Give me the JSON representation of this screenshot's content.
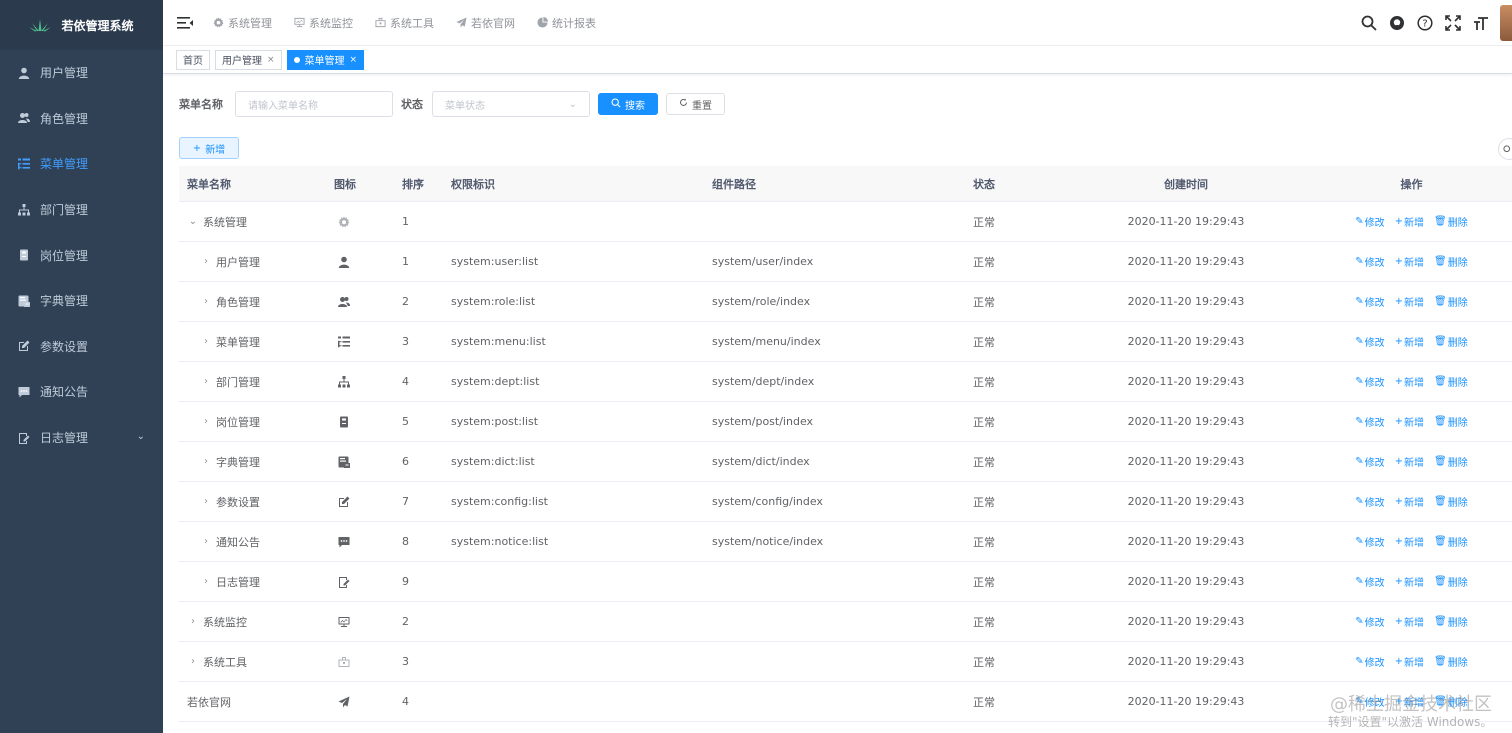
{
  "app": {
    "title": "若依管理系统"
  },
  "sidebar": {
    "items": [
      {
        "label": "用户管理",
        "icon": "user-icon"
      },
      {
        "label": "角色管理",
        "icon": "peoples-icon"
      },
      {
        "label": "菜单管理",
        "icon": "tree-table-icon",
        "active": true
      },
      {
        "label": "部门管理",
        "icon": "tree-icon"
      },
      {
        "label": "岗位管理",
        "icon": "post-icon"
      },
      {
        "label": "字典管理",
        "icon": "dict-icon"
      },
      {
        "label": "参数设置",
        "icon": "edit-icon"
      },
      {
        "label": "通知公告",
        "icon": "message-icon"
      },
      {
        "label": "日志管理",
        "icon": "log-icon",
        "has_children": true
      }
    ]
  },
  "navbar": {
    "menus": [
      {
        "label": "系统管理",
        "icon": "gear-icon"
      },
      {
        "label": "系统监控",
        "icon": "monitor-icon"
      },
      {
        "label": "系统工具",
        "icon": "tool-icon"
      },
      {
        "label": "若依官网",
        "icon": "send-icon"
      },
      {
        "label": "统计报表",
        "icon": "chart-icon"
      }
    ]
  },
  "tags": [
    {
      "label": "首页"
    },
    {
      "label": "用户管理",
      "closable": true
    },
    {
      "label": "菜单管理",
      "closable": true,
      "active": true
    }
  ],
  "search": {
    "menu_name_label": "菜单名称",
    "menu_name_placeholder": "请输入菜单名称",
    "status_label": "状态",
    "status_placeholder": "菜单状态",
    "search_button": "搜索",
    "reset_button": "重置"
  },
  "toolbar": {
    "add_button": "新增"
  },
  "table": {
    "headers": {
      "name": "菜单名称",
      "icon": "图标",
      "sort": "排序",
      "perms": "权限标识",
      "component": "组件路径",
      "status": "状态",
      "created": "创建时间",
      "ops": "操作"
    },
    "ops": {
      "edit": "修改",
      "add": "新增",
      "delete": "删除"
    },
    "rows": [
      {
        "name": "系统管理",
        "level": 0,
        "expander": "⌄",
        "icon": "gear-icon",
        "sort": "1",
        "perms": "",
        "component": "",
        "status": "正常",
        "created": "2020-11-20 19:29:43"
      },
      {
        "name": "用户管理",
        "level": 1,
        "expander": "›",
        "icon": "user-icon",
        "sort": "1",
        "perms": "system:user:list",
        "component": "system/user/index",
        "status": "正常",
        "created": "2020-11-20 19:29:43"
      },
      {
        "name": "角色管理",
        "level": 1,
        "expander": "›",
        "icon": "peoples-icon",
        "sort": "2",
        "perms": "system:role:list",
        "component": "system/role/index",
        "status": "正常",
        "created": "2020-11-20 19:29:43"
      },
      {
        "name": "菜单管理",
        "level": 1,
        "expander": "›",
        "icon": "tree-table-icon",
        "sort": "3",
        "perms": "system:menu:list",
        "component": "system/menu/index",
        "status": "正常",
        "created": "2020-11-20 19:29:43"
      },
      {
        "name": "部门管理",
        "level": 1,
        "expander": "›",
        "icon": "tree-icon",
        "sort": "4",
        "perms": "system:dept:list",
        "component": "system/dept/index",
        "status": "正常",
        "created": "2020-11-20 19:29:43"
      },
      {
        "name": "岗位管理",
        "level": 1,
        "expander": "›",
        "icon": "post-icon",
        "sort": "5",
        "perms": "system:post:list",
        "component": "system/post/index",
        "status": "正常",
        "created": "2020-11-20 19:29:43"
      },
      {
        "name": "字典管理",
        "level": 1,
        "expander": "›",
        "icon": "dict-icon",
        "sort": "6",
        "perms": "system:dict:list",
        "component": "system/dict/index",
        "status": "正常",
        "created": "2020-11-20 19:29:43"
      },
      {
        "name": "参数设置",
        "level": 1,
        "expander": "›",
        "icon": "edit-icon",
        "sort": "7",
        "perms": "system:config:list",
        "component": "system/config/index",
        "status": "正常",
        "created": "2020-11-20 19:29:43"
      },
      {
        "name": "通知公告",
        "level": 1,
        "expander": "›",
        "icon": "message-icon",
        "sort": "8",
        "perms": "system:notice:list",
        "component": "system/notice/index",
        "status": "正常",
        "created": "2020-11-20 19:29:43"
      },
      {
        "name": "日志管理",
        "level": 1,
        "expander": "›",
        "icon": "log-icon",
        "sort": "9",
        "perms": "",
        "component": "",
        "status": "正常",
        "created": "2020-11-20 19:29:43"
      },
      {
        "name": "系统监控",
        "level": 0,
        "expander": "›",
        "icon": "monitor-icon",
        "sort": "2",
        "perms": "",
        "component": "",
        "status": "正常",
        "created": "2020-11-20 19:29:43"
      },
      {
        "name": "系统工具",
        "level": 0,
        "expander": "›",
        "icon": "tool-icon",
        "sort": "3",
        "perms": "",
        "component": "",
        "status": "正常",
        "created": "2020-11-20 19:29:43"
      },
      {
        "name": "若依官网",
        "level": 0,
        "expander": "",
        "icon": "send-icon",
        "sort": "4",
        "perms": "",
        "component": "",
        "status": "正常",
        "created": "2020-11-20 19:29:43"
      }
    ]
  },
  "watermark": {
    "line1": "@稀土掘金技术社区",
    "line2": "转到\"设置\"以激活 Windows。"
  },
  "colors": {
    "sidebar_bg": "#304156",
    "primary": "#1890ff",
    "active_menu": "#409eff"
  }
}
